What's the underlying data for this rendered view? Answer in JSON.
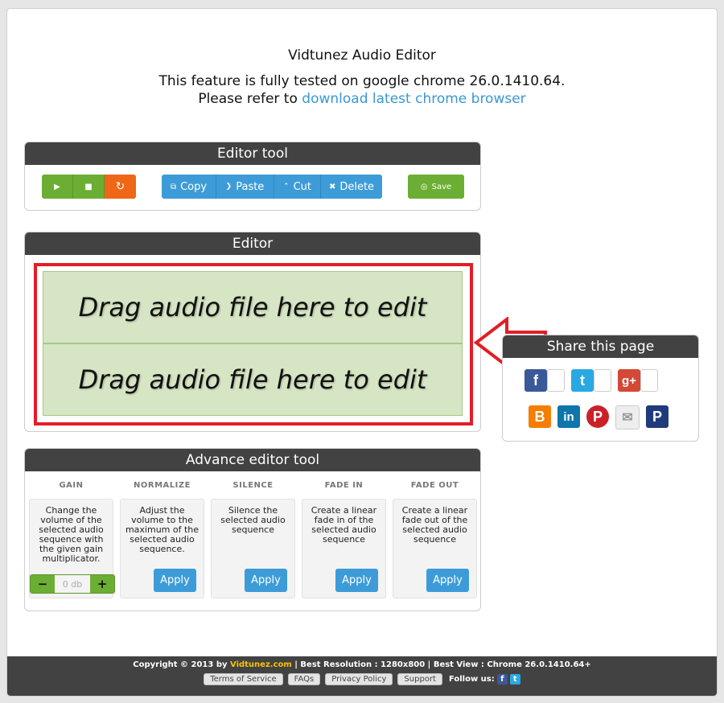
{
  "header": {
    "title": "Vidtunez Audio Editor",
    "notice_line1": "This feature is fully tested on google chrome 26.0.1410.64.",
    "notice_line2_prefix": "Please refer to",
    "notice_link": "download latest chrome browser"
  },
  "editor_tool": {
    "title": "Editor tool",
    "copy": "Copy",
    "paste": "Paste",
    "cut": "Cut",
    "delete": "Delete",
    "save": "Save"
  },
  "editor": {
    "title": "Editor",
    "track1": "Drag audio file here to edit",
    "track2": "Drag audio file here to edit"
  },
  "share": {
    "title": "Share this page",
    "icons": [
      "facebook-icon",
      "twitter-icon",
      "google-plus-icon",
      "blogger-icon",
      "linkedin-icon",
      "pinterest-icon",
      "email-icon",
      "pinterest-icon"
    ]
  },
  "advance": {
    "title": "Advance editor tool",
    "tools": [
      {
        "name": "GAIN",
        "desc": "Change the volume of the selected audio sequence with the given gain multiplicator."
      },
      {
        "name": "NORMALIZE",
        "desc": "Adjust the volume to the maximum of the selected audio sequence.",
        "apply": "Apply"
      },
      {
        "name": "SILENCE",
        "desc": "Silence the selected audio sequence",
        "apply": "Apply"
      },
      {
        "name": "FADE IN",
        "desc": "Create a linear fade in of the selected audio sequence",
        "apply": "Apply"
      },
      {
        "name": "FADE OUT",
        "desc": "Create a linear fade out of the selected audio sequence",
        "apply": "Apply"
      }
    ],
    "gain_minus": "−",
    "gain_plus": "+",
    "gain_placeholder": "0 db"
  },
  "footer": {
    "copy_prefix": "Copyright © 2013 by",
    "site": "Vidtunez.com",
    "copy_suffix": "| Best Resolution : 1280x800 | Best View : Chrome 26.0.1410.64+",
    "links": [
      "Terms of Service",
      "FAQs",
      "Privacy Policy",
      "Support"
    ],
    "follow": "Follow us:"
  },
  "colors": {
    "accent_blue": "#3d9cd8",
    "green": "#6cae33",
    "orange": "#f06617",
    "highlight_red": "#e41d25"
  }
}
